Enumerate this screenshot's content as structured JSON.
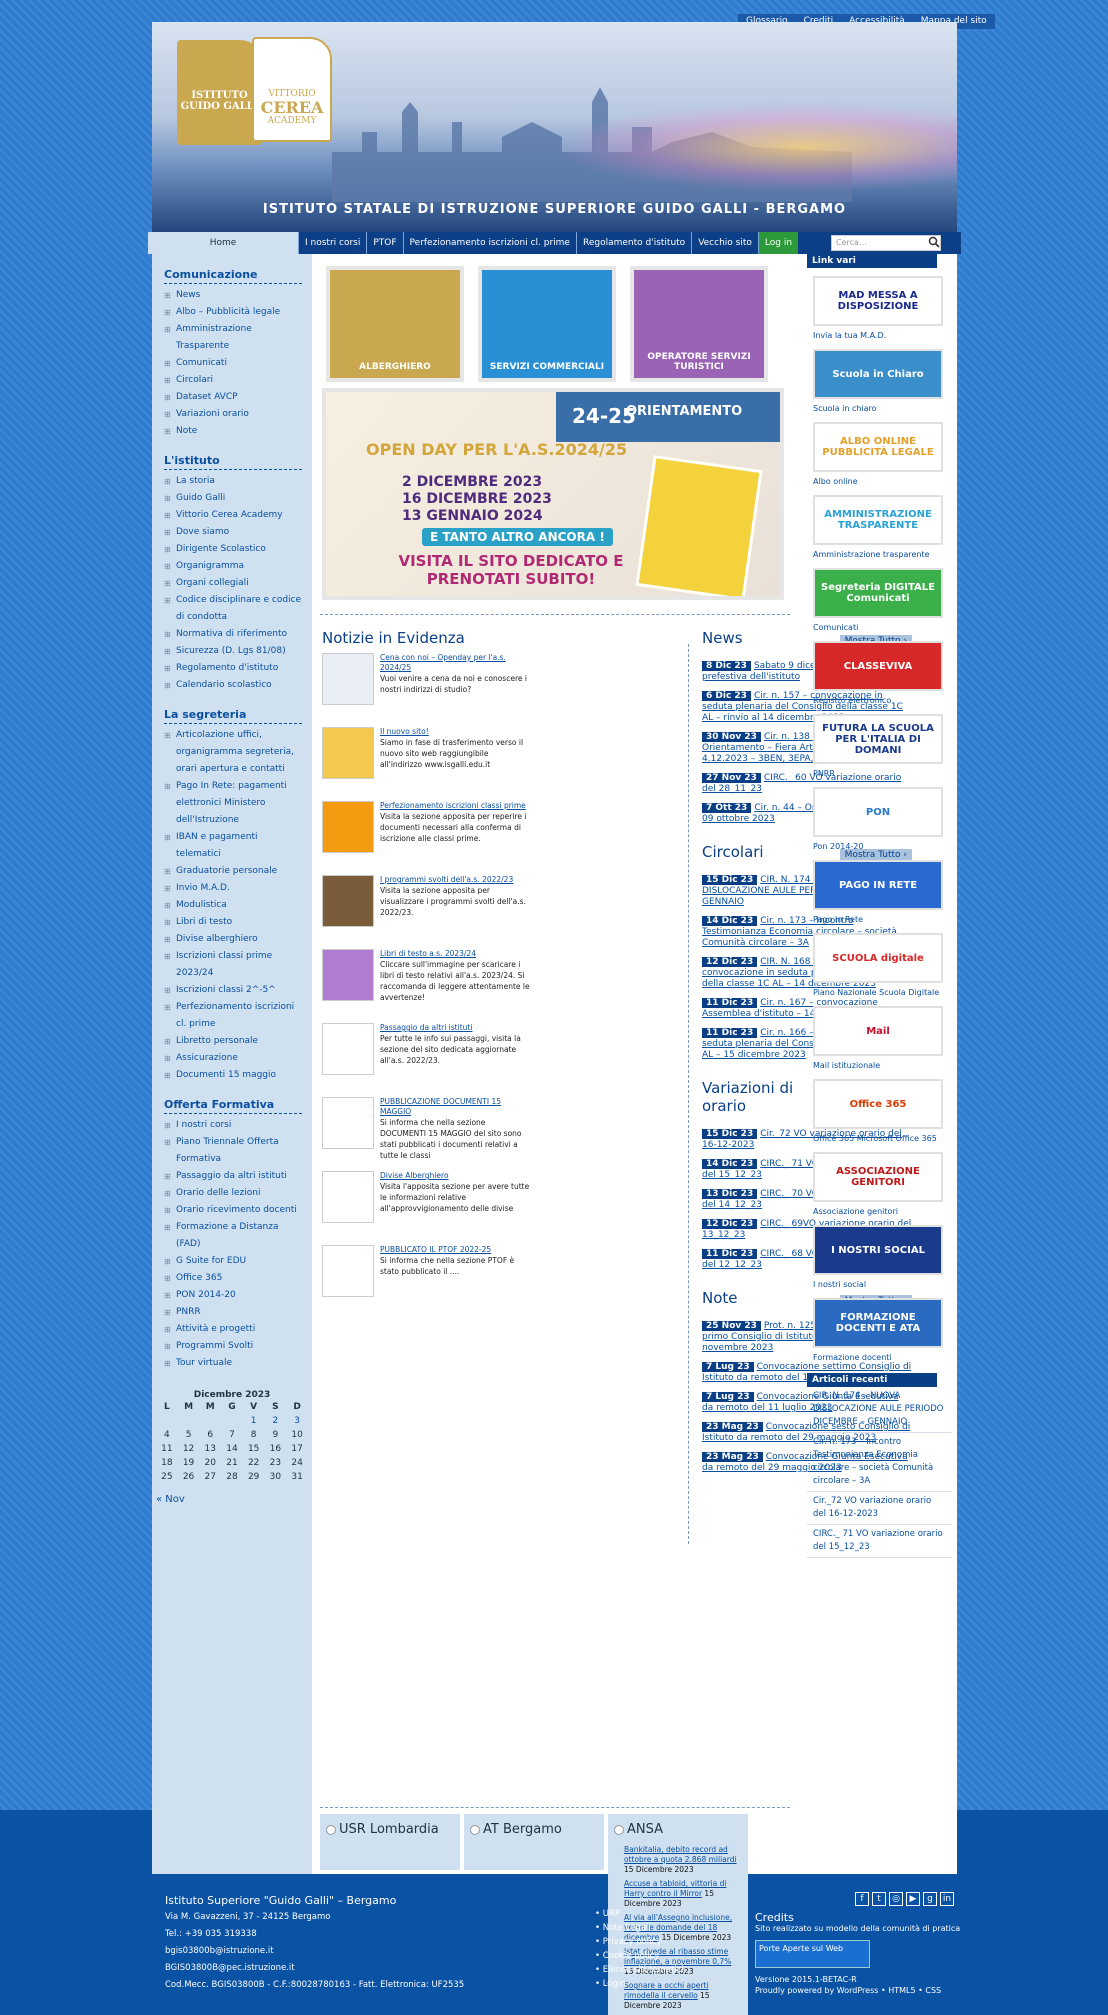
{
  "toplinks": [
    "Glossario",
    "Crediti",
    "Accessibilità",
    "Mappa del sito"
  ],
  "header": {
    "logo1": "ISTITUTO GUIDO GALLI",
    "logo2a": "VITTORIO",
    "logo2b": "CEREA",
    "logo2c": "ACADEMY",
    "title": "ISTITUTO STATALE DI ISTRUZIONE SUPERIORE GUIDO GALLI - BERGAMO"
  },
  "nav": {
    "home": "Home",
    "items": [
      "I nostri corsi",
      "PTOF",
      "Perfezionamento iscrizioni cl. prime",
      "Regolamento d'istituto",
      "Vecchio sito"
    ],
    "login": "Log in",
    "search_placeholder": "Cerca…"
  },
  "left": {
    "comunicazione": {
      "title": "Comunicazione",
      "items": [
        "News",
        "Albo – Pubblicità legale",
        "Amministrazione Trasparente",
        "Comunicati",
        "Circolari",
        "Dataset AVCP",
        "Variazioni orario",
        "Note"
      ]
    },
    "istituto": {
      "title": "L'istituto",
      "items": [
        "La storia",
        "Guido Galli",
        "Vittorio Cerea Academy",
        "Dove siamo",
        "Dirigente Scolastico",
        "Organigramma",
        "Organi collegiali",
        "Codice disciplinare e codice di condotta",
        "Normativa di riferimento",
        "Sicurezza (D. Lgs 81/08)",
        "Regolamento d'istituto",
        "Calendario scolastico"
      ]
    },
    "segreteria": {
      "title": "La segreteria",
      "items": [
        "Articolazione uffici, organigramma segreteria, orari apertura e contatti",
        "Pago In Rete: pagamenti elettronici Ministero dell'Istruzione",
        "IBAN e pagamenti telematici",
        "Graduatorie personale",
        "Invio M.A.D.",
        "Modulistica",
        "Libri di testo",
        "Divise alberghiero",
        "Iscrizioni classi prime 2023/24",
        "Iscrizioni classi 2^-5^",
        "Perfezionamento iscrizioni cl. prime",
        "Libretto personale",
        "Assicurazione",
        "Documenti 15 maggio"
      ]
    },
    "offerta": {
      "title": "Offerta Formativa",
      "items": [
        "I nostri corsi",
        "Piano Triennale Offerta Formativa",
        "Passaggio da altri istituti",
        "Orario delle lezioni",
        "Orario ricevimento docenti",
        "Formazione a Distanza (FAD)",
        "G Suite for EDU",
        "Office 365",
        "PON 2014-20",
        "PNRR",
        "Attività e progetti",
        "Programmi Svolti",
        "Tour virtuale"
      ]
    },
    "calendar": {
      "title": "Dicembre 2023",
      "days": [
        "L",
        "M",
        "M",
        "G",
        "V",
        "S",
        "D"
      ],
      "weeks": [
        [
          "",
          "",
          "",
          "",
          "1",
          "2",
          "3"
        ],
        [
          "4",
          "5",
          "6",
          "7",
          "8",
          "9",
          "10"
        ],
        [
          "11",
          "12",
          "13",
          "14",
          "15",
          "16",
          "17"
        ],
        [
          "18",
          "19",
          "20",
          "21",
          "22",
          "23",
          "24"
        ],
        [
          "25",
          "26",
          "27",
          "28",
          "29",
          "30",
          "31"
        ]
      ],
      "prev": "« Nov"
    }
  },
  "tiles": [
    "ALBERGHIERO",
    "SERVIZI COMMERCIALI",
    "OPERATORE SERVIZI TURISTICI"
  ],
  "openday": {
    "headline": "OPEN DAY PER L'A.S.2024/25",
    "dates": [
      "2 DICEMBRE 2023",
      "16 DICEMBRE 2023",
      "13 GENNAIO 2024"
    ],
    "more": "E TANTO ALTRO ANCORA !",
    "visit": "VISITA IL SITO DEDICATO E PRENOTATI SUBITO!",
    "badge": "24-25",
    "badge2": "ORIENTAMENTO"
  },
  "evidenza": {
    "title": "Notizie in Evidenza",
    "items": [
      {
        "t": "Cena con noi – Openday per l'a.s. 2024/25",
        "d": "Vuoi venire a cena da noi e conoscere i nostri indirizzi di studio?"
      },
      {
        "t": "Il nuovo sito!",
        "d": "Siamo in fase di trasferimento verso il nuovo sito web raggiungibile all'indirizzo www.isgalli.edu.it"
      },
      {
        "t": "Perfezionamento iscrizioni classi prime",
        "d": "Visita la sezione apposita per reperire i documenti necessari alla conferma di iscrizione alle classi prime."
      },
      {
        "t": "I programmi svolti dell'a.s. 2022/23",
        "d": "Visita la sezione apposita per visualizzare i programmi svolti dell'a.s. 2022/23."
      },
      {
        "t": "Libri di testo a.s. 2023/24",
        "d": "Cliccare sull'immagine per scaricare i libri di testo relativi all'a.s. 2023/24. Si raccomanda di leggere attentamente le avvertenze!"
      },
      {
        "t": "Passaggio da altri istituti",
        "d": "Per tutte le info sui passaggi, visita la sezione del sito dedicata aggiornate all'a.s. 2022/23."
      },
      {
        "t": "PUBBLICAZIONE DOCUMENTI 15 MAGGIO",
        "d": "Si informa che nella sezione DOCUMENTI 15 MAGGIO del sito sono stati pubblicati i documenti relativi a tutte le classi"
      },
      {
        "t": "Divise Alberghiero",
        "d": "Visita l'apposita sezione per avere tutte le informazioni relative all'approvvigionamento delle divise"
      },
      {
        "t": "PUBBLICATO IL PTOF 2022-25",
        "d": "Si informa che nella sezione PTOF è stato pubblicato il ...."
      }
    ]
  },
  "more_label": "Mostra Tutto ›",
  "news": {
    "title": "News",
    "items": [
      {
        "d": "8 Dic 23",
        "t": "Sabato 9 dicembre 2023 chiusura prefestiva dell'istituto"
      },
      {
        "d": "6 Dic 23",
        "t": "Cir. n. 157 – convocazione in seduta plenaria del Consiglio della classe 1C AL – rinvio al 14 dicembre 2023"
      },
      {
        "d": "30 Nov 23",
        "t": "Cir. n. 138 – Uscita Progetto Orientamento – Fiera Artigianato Rho 4.12.2023 – 3BEN, 3EPA, 3GAC, 5GAC"
      },
      {
        "d": "27 Nov 23",
        "t": "CIRC._ 60 VO variazione orario del 28_11_23"
      },
      {
        "d": "7 Ott 23",
        "t": "Cir. n. 44 – Orario delle lezioni dal 09 ottobre 2023"
      }
    ]
  },
  "circolari": {
    "title": "Circolari",
    "items": [
      {
        "d": "15 Dic 23",
        "t": "CIR. N. 174 – NUOVA DISLOCAZIONE AULE PERIODO DICEMBRE – GENNAIO"
      },
      {
        "d": "14 Dic 23",
        "t": "Cir. n. 173 – Incontro Testimonianza Economia circolare – società Comunità circolare – 3A"
      },
      {
        "d": "12 Dic 23",
        "t": "CIR. N. 168 VARIAZIONE ORARIO convocazione in seduta plenaria del Consiglio della classe 1C AL – 14 dicembre 2023"
      },
      {
        "d": "11 Dic 23",
        "t": "Cir. n. 167 – convocazione Assemblea d'istituto – 14 dicembre 2023"
      },
      {
        "d": "11 Dic 23",
        "t": "Cir. n. 166 – Convocazione in seduta plenaria del Consiglio della classe 1E AL – 15 dicembre 2023"
      }
    ]
  },
  "variazioni": {
    "title": "Variazioni di orario",
    "items": [
      {
        "d": "15 Dic 23",
        "t": "Cir._72 VO variazione orario del 16-12-2023"
      },
      {
        "d": "14 Dic 23",
        "t": "CIRC._ 71 VO variazione orario del 15_12_23"
      },
      {
        "d": "13 Dic 23",
        "t": "CIRC._ 70 VO variazione orario del 14_12_23"
      },
      {
        "d": "12 Dic 23",
        "t": "CIRC._ 69VO variazione orario del 13_12_23"
      },
      {
        "d": "11 Dic 23",
        "t": "CIRC._ 68 VO variazione orario del 12_12_23"
      }
    ]
  },
  "note": {
    "title": "Note",
    "items": [
      {
        "d": "25 Nov 23",
        "t": "Prot. n. 12555 Convocazione primo Consiglio di Istituto da remoto del 30 novembre 2023"
      },
      {
        "d": "7 Lug 23",
        "t": "Convocazione settimo Consiglio di Istituto da remoto del 11 luglio 2023"
      },
      {
        "d": "7 Lug 23",
        "t": "Convocazione Giunta Esecutiva da remoto del 11 luglio 2023"
      },
      {
        "d": "23 Mag 23",
        "t": "Convocazione sesto Consiglio di Istituto da remoto del 29 maggio 2023"
      },
      {
        "d": "23 Mag 23",
        "t": "Convocazione Giunta Esecutiva da remoto del 29 maggio 2023"
      }
    ]
  },
  "feeds": {
    "f1": "USR Lombardia",
    "f2": "AT Bergamo",
    "f3": "ANSA",
    "ansa": [
      {
        "t": "Bankitalia, debito record ad ottobre a quota 2.868 miliardi",
        "d": " 15 Dicembre 2023"
      },
      {
        "t": "Accuse a tabloid, vittoria di Harry contro il Mirror",
        "d": " 15 Dicembre 2023"
      },
      {
        "t": "Al via all'Assegno inclusione, verso le domande del 18 dicembre",
        "d": " 15 Dicembre 2023"
      },
      {
        "t": "Istat rivede al ribasso stime inflazione, a novembre 0,7%",
        "d": " 15 Dicembre 2023"
      },
      {
        "t": "Sognare a occhi aperti rimodella il cervello",
        "d": " 15 Dicembre 2023"
      }
    ]
  },
  "right": {
    "title": "Link vari",
    "links": [
      {
        "b": "MAD MESSA A DISPOSIZIONE",
        "l": "Invia la tua M.A.D."
      },
      {
        "b": "Scuola in Chiaro",
        "l": "Scuola in chiaro"
      },
      {
        "b": "ALBO ONLINE PUBBLICITÀ LEGALE",
        "l": "Albo online"
      },
      {
        "b": "AMMINISTRAZIONE TRASPARENTE",
        "l": "Amministrazione trasparente"
      },
      {
        "b": "Segreteria DIGITALE Comunicati",
        "l": "Comunicati"
      },
      {
        "b": "CLASSEVIVA",
        "l": "Registro elettronico"
      },
      {
        "b": "FUTURA LA SCUOLA PER L'ITALIA DI DOMANI",
        "l": "PNRR"
      },
      {
        "b": "PON",
        "l": "Pon 2014-20"
      },
      {
        "b": "PAGO IN RETE",
        "l": "Pago In Rete"
      },
      {
        "b": "SCUOLA digitale",
        "l": "Piano Nazionale Scuola Digitale"
      },
      {
        "b": "Mail",
        "l": "Mail istituzionale"
      },
      {
        "b": "Office 365",
        "l": "Office 365 Microsoft Office 365"
      },
      {
        "b": "ASSOCIAZIONE GENITORI",
        "l": "Associazione genitori"
      },
      {
        "b": "I NOSTRI SOCIAL",
        "l": "I nostri social"
      },
      {
        "b": "FORMAZIONE DOCENTI E ATA",
        "l": "Formazione docenti"
      }
    ],
    "recent_title": "Articoli recenti",
    "recent": [
      "CIR. N. 174 – NUOVA DISLOCAZIONE AULE PERIODO DICEMBRE – GENNAIO",
      "Cir. n. 173 – Incontro Testimonianza Economia circolare – società Comunità circolare – 3A",
      "Cir._72 VO variazione orario del 16-12-2023",
      "CIRC._ 71 VO variazione orario del 15_12_23"
    ]
  },
  "footer": {
    "name": "Istituto Superiore \"Guido Galli\" – Bergamo",
    "addr": "Via M. Gavazzeni, 37 - 24125 Bergamo",
    "tel": "Tel.: +39 035 319338",
    "mail": "bgis03800b@istruzione.it",
    "pec": "BGIS03800B@pec.istruzione.it",
    "cod": "Cod.Mecc. BGIS03800B - C.F.:80028780163 - Fatt. Elettronica: UF2535",
    "menu": [
      "URP",
      "Note Legali",
      "Privacy policy",
      "Cookie policy",
      "Elenco siti tematici",
      "Login"
    ],
    "credits": "Credits",
    "credits_text": "Sito realizzato su modello della comunità di pratica",
    "paw": "Porte Aperte sul Web",
    "version": "Versione 2015.1-BETAC-R",
    "powered": "Proudly powered by WordPress • HTML5 • CSS"
  }
}
